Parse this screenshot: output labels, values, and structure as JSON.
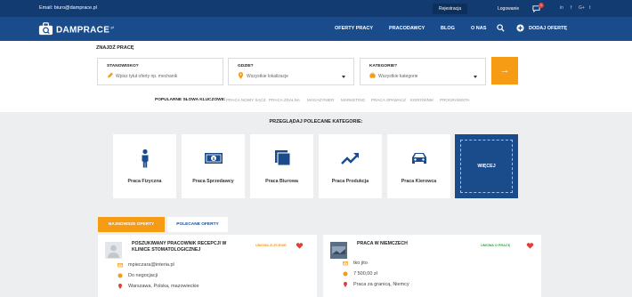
{
  "topbar": {
    "email": "Email: biuro@damprace.pl",
    "register": "Rejestracja",
    "login": "Logowanie",
    "message_count": "1",
    "social": [
      "in",
      "f",
      "G+",
      "t"
    ]
  },
  "nav": {
    "logo": "DAMPRACE",
    "logo_suffix": ".pl",
    "items": [
      "OFERTY PRACY",
      "PRACODAWCY",
      "BLOG",
      "O NAS"
    ],
    "add_offer": "DODAJ OFERTĘ"
  },
  "search": {
    "title": "ZNAJDŹ PRACĘ",
    "position_label": "STANOWISKO?",
    "position_placeholder": "Wpisz tytuł oferty np. mechanik",
    "where_label": "GDZIE?",
    "where_value": "Wszystkie lokalizacje",
    "category_label": "KATEGORIE?",
    "category_value": "Wszystkie kategorie",
    "go": "→"
  },
  "keywords": {
    "label": "POPULARNE SŁOWA KLUCZOWE:",
    "items": [
      "PRACA NOWY SĄCZ",
      "PRACA ZDALNA",
      "MAGAZYNIER",
      "MARKETING",
      "PRACA SPAWACZ",
      "KIEROWNIK",
      "PROGRAMISTA"
    ]
  },
  "categories": {
    "title": "PRZEGLĄDAJ POLECANE KATEGORIE:",
    "items": [
      {
        "label": "Praca Fizyczna",
        "icon": "person-icon"
      },
      {
        "label": "Praca Sprzedawcy",
        "icon": "money-icon"
      },
      {
        "label": "Praca Biurowa",
        "icon": "documents-icon"
      },
      {
        "label": "Praca Produkcja",
        "icon": "trend-icon"
      },
      {
        "label": "Praca Kierowca",
        "icon": "car-icon"
      }
    ],
    "more": "WIĘCEJ"
  },
  "offers": {
    "tab_newest": "NAJNOWSZE OFERTY",
    "tab_recommended": "POLECANE OFERTY",
    "list": [
      {
        "title_line1": "POSZUKIWANY PRACOWNIK RECEPCJI W",
        "title_line2": "KLINICE STOMATOLOGICZNEJ",
        "status": "UMOWA ZLECENIE",
        "email": "mpieczara@interia.pl",
        "salary": "Do negocjacji",
        "location": "Warszawa, Polska, mazowieckie"
      },
      {
        "title_line1": "PRACA W NIEMCZECH",
        "title_line2": "",
        "status": "UMOWA O PRACĘ",
        "email": "tko jito",
        "salary": "7 500,00 zł",
        "location": "Praca za granicą, Niemcy"
      }
    ]
  },
  "colors": {
    "navy": "#123c71",
    "blue": "#1a4c8c",
    "orange": "#f59b14",
    "red": "#e0403a",
    "green": "#3aa54a"
  }
}
